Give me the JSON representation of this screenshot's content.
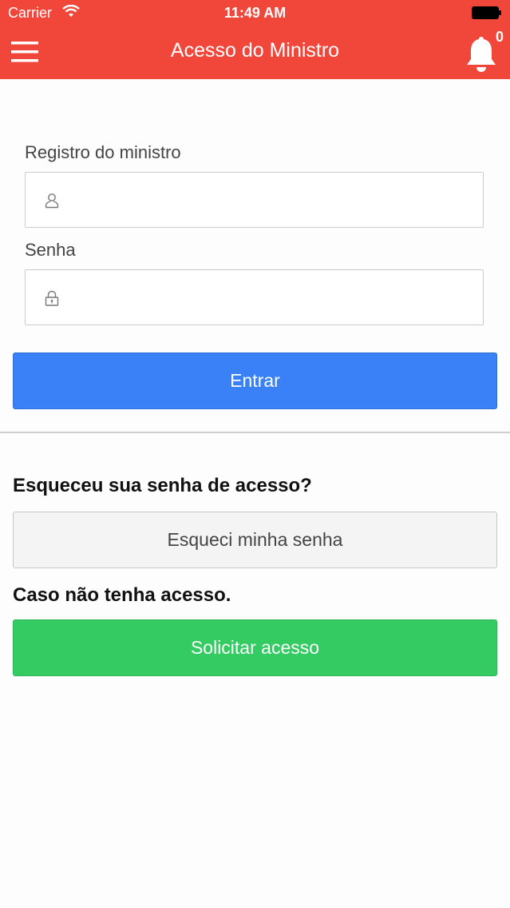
{
  "status_bar": {
    "carrier": "Carrier",
    "time": "11:49 AM"
  },
  "nav": {
    "title": "Acesso do Ministro",
    "notification_count": "0"
  },
  "login": {
    "registro_label": "Registro do ministro",
    "registro_value": "",
    "senha_label": "Senha",
    "senha_value": "",
    "submit_label": "Entrar"
  },
  "forgot": {
    "heading": "Esqueceu sua senha de acesso?",
    "button_label": "Esqueci minha senha"
  },
  "request": {
    "heading": "Caso não tenha acesso.",
    "button_label": "Solicitar acesso"
  },
  "colors": {
    "header": "#f1473b",
    "primary": "#3a80f6",
    "success": "#33cb62",
    "default_button": "#f5f4f5"
  },
  "icons": {
    "menu": "hamburger-menu-icon",
    "bell": "bell-icon",
    "user": "user-icon",
    "lock": "lock-icon",
    "wifi": "wifi-icon",
    "battery": "battery-icon"
  }
}
